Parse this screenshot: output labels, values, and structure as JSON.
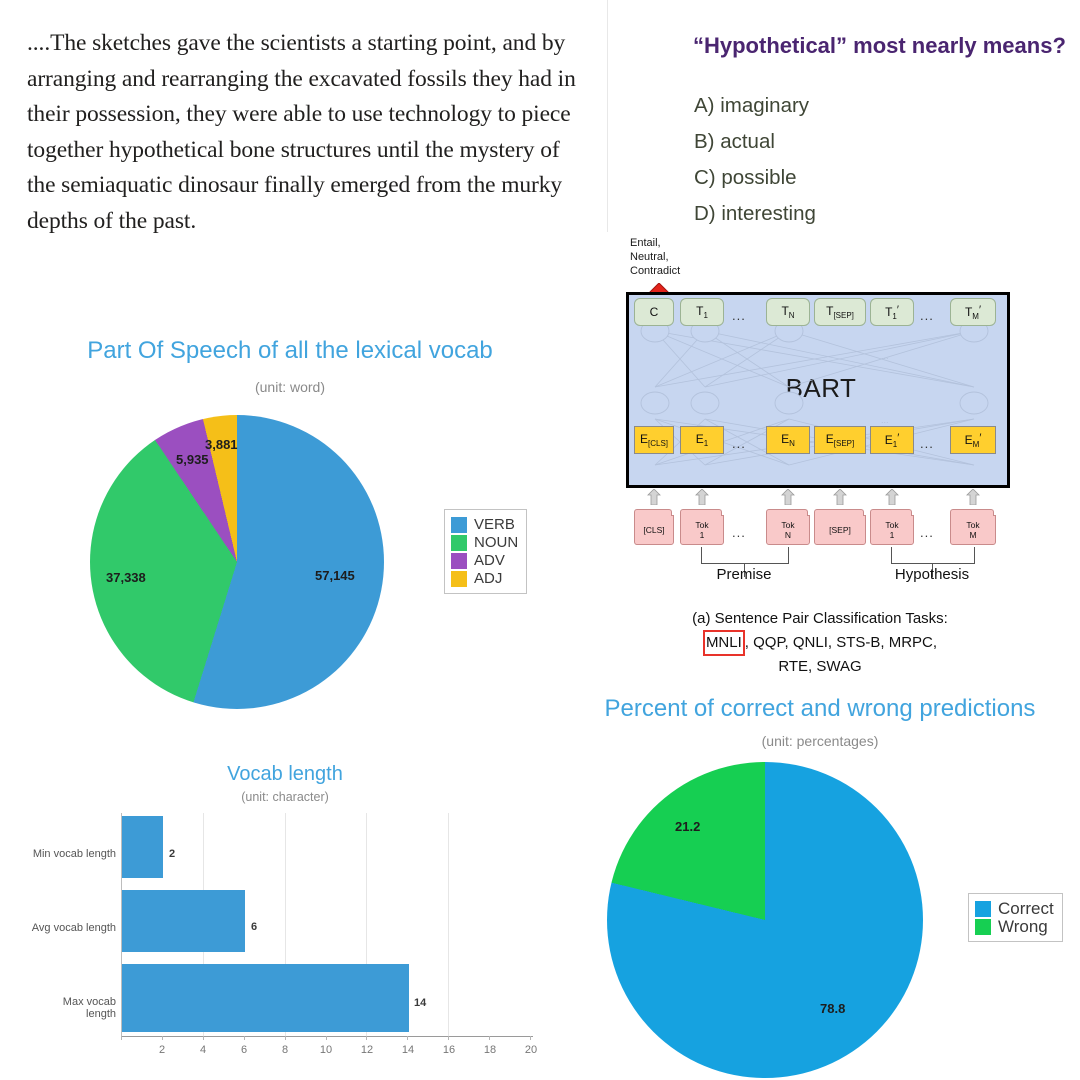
{
  "passage": {
    "text": "....The sketches gave the scientists a starting point, and by arranging and rearranging the excavated fossils they had in their possession, they were able to use technology to piece together hypothetical bone structures until the mystery of the semiaquatic dinosaur finally emerged from the murky depths of the past."
  },
  "question": {
    "title": "“Hypothetical” most nearly means?",
    "options": [
      "A) imaginary",
      "B) actual",
      "C) possible",
      "D) interesting"
    ],
    "title_color": "#4a2570",
    "option_color": "#3f4636"
  },
  "bart_figure": {
    "output_label": "Entail,\nNeutral,\nContradict",
    "output_label_lines": [
      "Entail,",
      "Neutral,",
      "Contradict"
    ],
    "model_name": "BART",
    "arrow_color": "#e3231b",
    "box_color": "#c7d6f0",
    "top_tokens": [
      "C",
      "T1",
      "...",
      "TN",
      "T[SEP]",
      "T1'",
      "...",
      "TM'"
    ],
    "embeddings": [
      "E[CLS]",
      "E1",
      "...",
      "EN",
      "E[SEP]",
      "E1'",
      "...",
      "EM'"
    ],
    "input_tokens": [
      "[CLS]",
      "Tok 1",
      "...",
      "Tok N",
      "[SEP]",
      "Tok 1",
      "...",
      "Tok M"
    ],
    "groups": [
      "Premise",
      "Hypothesis"
    ],
    "caption_line1": "(a) Sentence Pair Classification Tasks:",
    "caption_highlight": "MNLI",
    "caption_line2_rest": ", QQP, QNLI, STS-B, MRPC,",
    "caption_line3": "RTE, SWAG",
    "highlight_color": "#e8332a"
  },
  "chart_data": [
    {
      "type": "pie",
      "title": "Part Of Speech of all the lexical vocab",
      "subtitle": "(unit: word)",
      "unit": "word",
      "labels": [
        "VERB",
        "NOUN",
        "ADV",
        "ADJ"
      ],
      "values": [
        57145,
        37338,
        5935,
        3881
      ],
      "value_labels": [
        "57,145",
        "37,338",
        "5,935",
        "3,881"
      ],
      "colors": [
        "#3d9bd6",
        "#31c96a",
        "#9b4fc0",
        "#f5bf18"
      ],
      "legend_position": "right",
      "start_angle": 0,
      "direction": "clockwise"
    },
    {
      "type": "bar",
      "orientation": "horizontal",
      "title": "Vocab length",
      "subtitle": "(unit: character)",
      "unit": "character",
      "categories": [
        "Min vocab length",
        "Avg vocab length",
        "Max vocab length"
      ],
      "values": [
        2,
        6,
        14
      ],
      "value_labels": [
        "2",
        "6",
        "14"
      ],
      "xlim": [
        0,
        20
      ],
      "xticks": [
        0,
        2,
        4,
        6,
        8,
        10,
        12,
        14,
        16,
        18,
        20
      ],
      "xtick_labels": [
        "",
        "2",
        "4",
        "6",
        "8",
        "10",
        "12",
        "14",
        "16",
        "18",
        "20"
      ],
      "gridlines": [
        4,
        8,
        12,
        16
      ],
      "grid": true,
      "bar_color": "#3d9bd6",
      "xlabel": "",
      "ylabel": ""
    },
    {
      "type": "pie",
      "title": "Percent of correct and wrong predictions",
      "subtitle": "(unit: percentages)",
      "unit": "percentages",
      "labels": [
        "Correct",
        "Wrong"
      ],
      "values": [
        78.8,
        21.2
      ],
      "value_labels": [
        "78.8",
        "21.2"
      ],
      "colors": [
        "#16a2e0",
        "#16cf52"
      ],
      "legend_position": "right",
      "start_angle": 0,
      "direction": "clockwise"
    }
  ]
}
